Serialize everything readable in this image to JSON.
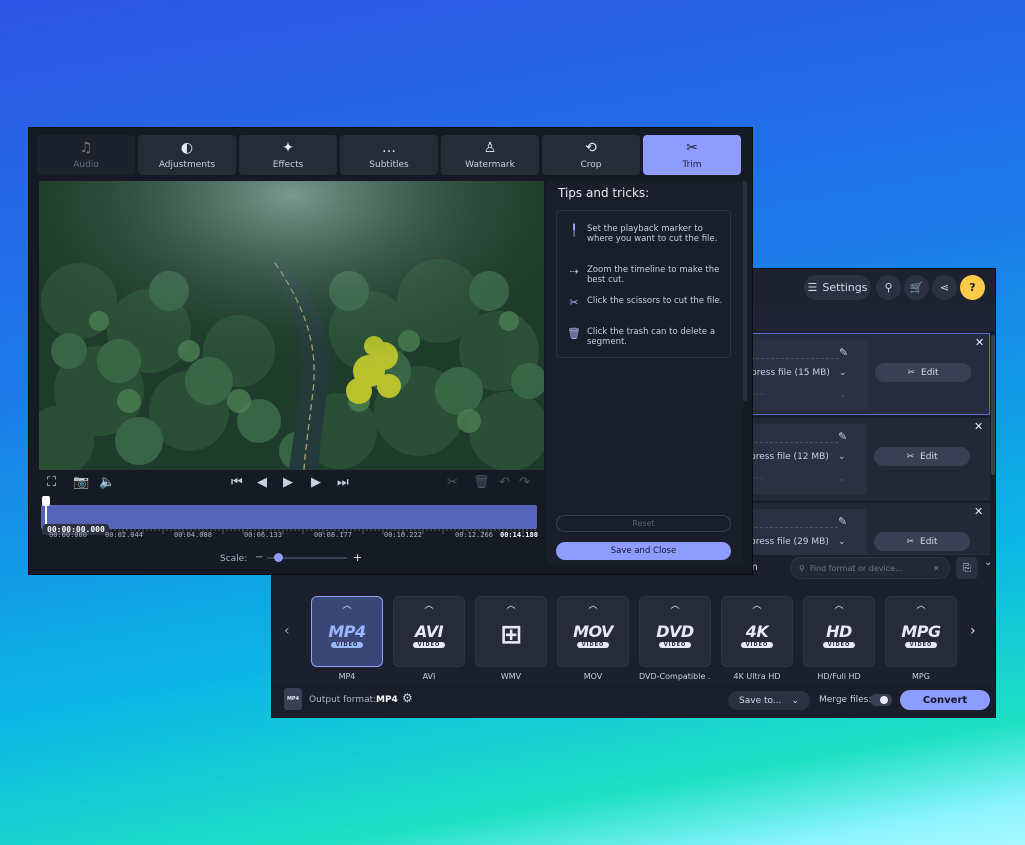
{
  "editor": {
    "tabs": [
      {
        "label": "Audio",
        "icon": "music-note-icon",
        "glyph": "♫",
        "state": "disabled"
      },
      {
        "label": "Adjustments",
        "icon": "contrast-icon",
        "glyph": "◐",
        "state": "normal"
      },
      {
        "label": "Effects",
        "icon": "magic-wand-icon",
        "glyph": "✦",
        "state": "normal"
      },
      {
        "label": "Subtitles",
        "icon": "speech-bubble-icon",
        "glyph": "…",
        "state": "normal"
      },
      {
        "label": "Watermark",
        "icon": "stamp-icon",
        "glyph": "♙",
        "state": "normal"
      },
      {
        "label": "Crop",
        "icon": "crop-rotate-icon",
        "glyph": "⟲",
        "state": "normal"
      },
      {
        "label": "Trim",
        "icon": "scissors-icon",
        "glyph": "✂",
        "state": "active"
      }
    ],
    "tips_title": "Tips and tricks:",
    "tips": [
      {
        "icon": "playback-marker-icon",
        "glyph": "╿",
        "text": "Set the playback marker to where you want to cut the file."
      },
      {
        "icon": "zoom-timeline-icon",
        "glyph": "⇢",
        "text": "Zoom the timeline to make the best cut."
      },
      {
        "icon": "scissors-icon",
        "glyph": "✂",
        "text": "Click the scissors to cut the file."
      },
      {
        "icon": "trash-icon",
        "glyph": "🗑",
        "text": "Click the trash can to delete a segment."
      }
    ],
    "reset_label": "Reset",
    "save_close_label": "Save and Close",
    "current_time": "00:00:00.000",
    "timeline_ticks": [
      "00:00:000",
      "00:02.044",
      "00:04.088",
      "00:06.133",
      "00:08.177",
      "00:10.222",
      "00:12.266",
      "00:14.180"
    ],
    "scale_label": "Scale:",
    "scale_minus": "−",
    "scale_plus": "+",
    "scale_level": 0.1
  },
  "converter": {
    "settings_label": "Settings",
    "files": [
      {
        "compress": "press file (15 MB)",
        "edit_label": "Edit",
        "selected": true
      },
      {
        "compress": "press file (12 MB)",
        "edit_label": "Edit",
        "selected": false
      },
      {
        "compress": "press file (29 MB)",
        "edit_label": "Edit",
        "selected": false
      }
    ],
    "format_tab_partial": "m",
    "search_placeholder": "Find format or device...",
    "formats": [
      {
        "logo": "MP4",
        "sub": "VIDEO",
        "name": "MP4",
        "active": true
      },
      {
        "logo": "AVI",
        "sub": "VIDEO",
        "name": "AVI",
        "active": false
      },
      {
        "logo": "⊞",
        "sub": "",
        "name": "WMV",
        "active": false
      },
      {
        "logo": "MOV",
        "sub": "VIDEO",
        "name": "MOV",
        "active": false
      },
      {
        "logo": "DVD",
        "sub": "VIDEO",
        "name": "DVD-Compatible ...",
        "active": false
      },
      {
        "logo": "4K",
        "sub": "VIDEO",
        "name": "4K Ultra HD",
        "active": false
      },
      {
        "logo": "HD",
        "sub": "VIDEO",
        "name": "HD/Full HD",
        "active": false
      },
      {
        "logo": "MPG",
        "sub": "VIDEO",
        "name": "MPG",
        "active": false
      }
    ],
    "output_format_label": "Output format:",
    "output_format_value": "MP4",
    "save_to_label": "Save to...",
    "merge_label": "Merge files:",
    "convert_label": "Convert",
    "small_format_icon": "MP4"
  },
  "colors": {
    "accent": "#8e9bff",
    "help": "#ffc94a"
  }
}
